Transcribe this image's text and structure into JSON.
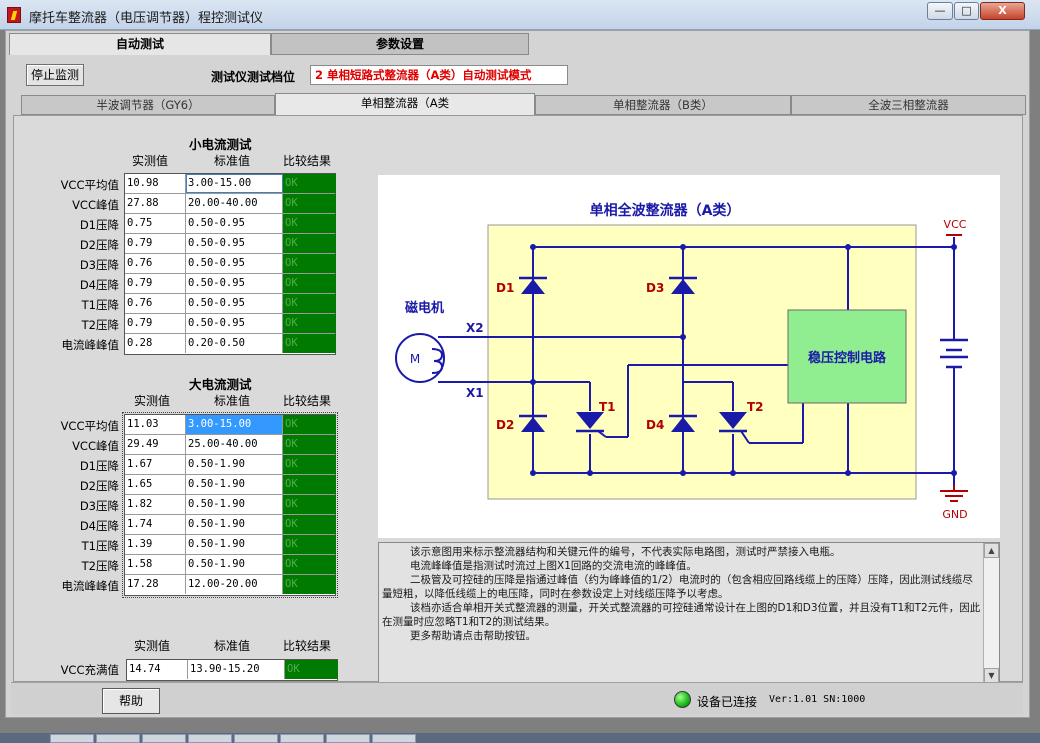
{
  "window": {
    "title": "摩托车整流器（电压调节器）程控测试仪",
    "min_label": "—",
    "max_label": "□",
    "close_label": "X"
  },
  "main_tabs": [
    {
      "label": "自动测试",
      "active": true
    },
    {
      "label": "参数设置",
      "active": false
    }
  ],
  "toolbar": {
    "stop_button": "停止监测",
    "mode_label": "测试仪测试档位",
    "mode_value": "2 单相短路式整流器（A类）自动测试模式"
  },
  "sub_tabs": [
    {
      "label": "半波调节器（GY6）",
      "active": false
    },
    {
      "label": "单相整流器（A类",
      "active": true
    },
    {
      "label": "单相整流器（B类）",
      "active": false
    },
    {
      "label": "全波三相整流器",
      "active": false
    }
  ],
  "headers": {
    "measured": "实测值",
    "standard": "标准值",
    "result": "比较结果"
  },
  "small_test": {
    "title": "小电流测试",
    "rows": [
      {
        "label": "VCC平均值",
        "measured": "10.98",
        "standard": "3.00-15.00",
        "result": "OK"
      },
      {
        "label": "VCC峰值",
        "measured": "27.88",
        "standard": "20.00-40.00",
        "result": "OK"
      },
      {
        "label": "D1压降",
        "measured": "0.75",
        "standard": "0.50-0.95",
        "result": "OK"
      },
      {
        "label": "D2压降",
        "measured": "0.79",
        "standard": "0.50-0.95",
        "result": "OK"
      },
      {
        "label": "D3压降",
        "measured": "0.76",
        "standard": "0.50-0.95",
        "result": "OK"
      },
      {
        "label": "D4压降",
        "measured": "0.79",
        "standard": "0.50-0.95",
        "result": "OK"
      },
      {
        "label": "T1压降",
        "measured": "0.76",
        "standard": "0.50-0.95",
        "result": "OK"
      },
      {
        "label": "T2压降",
        "measured": "0.79",
        "standard": "0.50-0.95",
        "result": "OK"
      },
      {
        "label": "电流峰峰值",
        "measured": "0.28",
        "standard": "0.20-0.50",
        "result": "OK"
      }
    ]
  },
  "large_test": {
    "title": "大电流测试",
    "rows": [
      {
        "label": "VCC平均值",
        "measured": "11.03",
        "standard": "3.00-15.00",
        "result": "OK"
      },
      {
        "label": "VCC峰值",
        "measured": "29.49",
        "standard": "25.00-40.00",
        "result": "OK"
      },
      {
        "label": "D1压降",
        "measured": "1.67",
        "standard": "0.50-1.90",
        "result": "OK"
      },
      {
        "label": "D2压降",
        "measured": "1.65",
        "standard": "0.50-1.90",
        "result": "OK"
      },
      {
        "label": "D3压降",
        "measured": "1.82",
        "standard": "0.50-1.90",
        "result": "OK"
      },
      {
        "label": "D4压降",
        "measured": "1.74",
        "standard": "0.50-1.90",
        "result": "OK"
      },
      {
        "label": "T1压降",
        "measured": "1.39",
        "standard": "0.50-1.90",
        "result": "OK"
      },
      {
        "label": "T2压降",
        "measured": "1.58",
        "standard": "0.50-1.90",
        "result": "OK"
      },
      {
        "label": "电流峰峰值",
        "measured": "17.28",
        "standard": "12.00-20.00",
        "result": "OK"
      }
    ]
  },
  "charge_test": {
    "label": "VCC充满值",
    "measured": "14.74",
    "standard": "13.90-15.20",
    "result": "OK"
  },
  "diagram": {
    "title": "单相全波整流器（A类）",
    "magneto_label": "磁电机",
    "motor_symbol": "M",
    "x1": "X1",
    "x2": "X2",
    "d1": "D1",
    "d2": "D2",
    "d3": "D3",
    "d4": "D4",
    "t1": "T1",
    "t2": "T2",
    "regulator": "稳压控制电路",
    "vcc": "VCC",
    "gnd": "GND",
    "colors": {
      "fill": "#ffffc0",
      "regulator": "#90ee90",
      "wire": "#1a1aa8",
      "label": "#b30000"
    }
  },
  "help_text": [
    "该示意图用来标示整流器结构和关键元件的编号，不代表实际电路图，测试时严禁接入电瓶。",
    "电流峰峰值是指测试时流过上图X1回路的交流电流的峰峰值。",
    "二极管及可控硅的压降是指通过峰值（约为峰峰值的1/2）电流时的（包含相应回路线缆上的压降）压降，因此测试线缆尽量短粗，以降低线缆上的电压降，同时在参数设定上对线缆压降予以考虑。",
    "该档亦适合单相开关式整流器的测量，开关式整流器的可控硅通常设计在上图的D1和D3位置，并且没有T1和T2元件，因此在测量时应忽略T1和T2的测试结果。",
    "更多帮助请点击帮助按钮。"
  ],
  "bottom": {
    "help_button": "帮助",
    "status": "设备已连接",
    "version": "Ver:1.01  SN:1000"
  }
}
